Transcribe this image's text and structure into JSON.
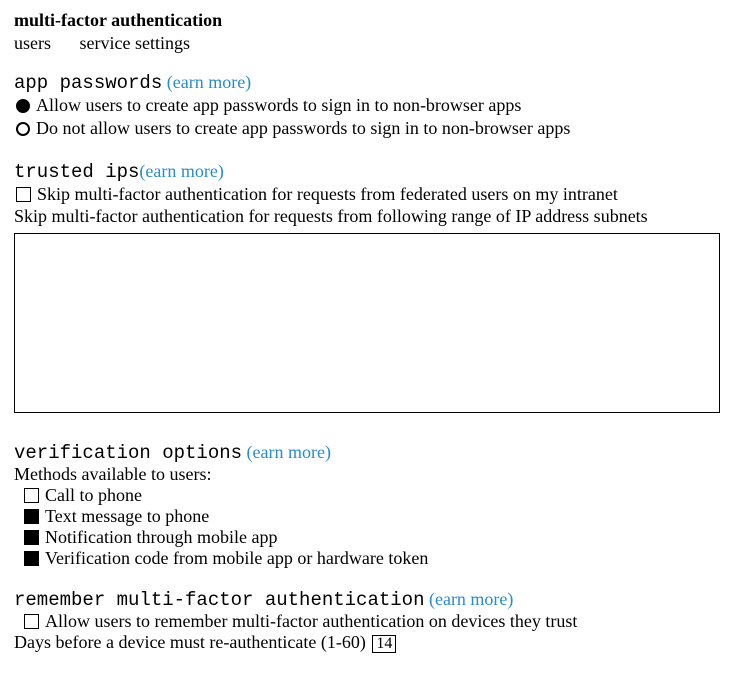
{
  "title": "multi-factor authentication",
  "tabs": {
    "users": "users",
    "service_settings": "service settings"
  },
  "learn_more_label": "(earn more)",
  "app_passwords": {
    "header": "app passwords",
    "option_allow": "Allow users to create app passwords to sign in to non-browser apps",
    "option_deny": "Do not allow users to create app passwords to sign in to non-browser apps",
    "selected": "allow"
  },
  "trusted_ips": {
    "header": "trusted ips",
    "skip_federated": "Skip multi-factor authentication for requests from federated users on my intranet",
    "skip_federated_checked": false,
    "skip_ip_range": "Skip multi-factor authentication for requests from following range of IP address subnets",
    "ip_value": ""
  },
  "verification_options": {
    "header": "verification options",
    "methods_label": "Methods available to users:",
    "methods": [
      {
        "label": "Call to phone",
        "checked": false
      },
      {
        "label": "Text message to phone",
        "checked": true
      },
      {
        "label": "Notification through mobile app",
        "checked": true
      },
      {
        "label": "Verification code from mobile app or hardware token",
        "checked": true
      }
    ]
  },
  "remember_mfa": {
    "header": "remember multi-factor authentication",
    "allow_label": "Allow users to remember multi-factor authentication on devices they trust",
    "allow_checked": false,
    "days_label": "Days before a device must re-authenticate (1-60)",
    "days_value": "14"
  }
}
